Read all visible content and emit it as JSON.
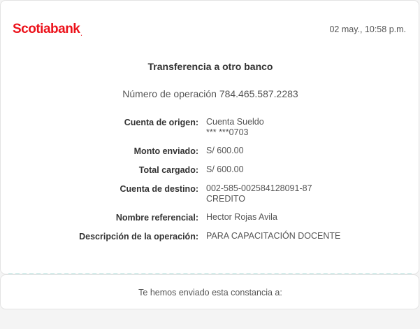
{
  "header": {
    "brand": "Scotiabank",
    "brand_mark": ".",
    "datetime": "02 may., 10:58 p.m."
  },
  "receipt": {
    "title": "Transferencia a otro banco",
    "operation_label": "Número de operación",
    "operation_number": "784.465.587.2283",
    "rows": [
      {
        "label": "Cuenta de origen:",
        "value_line1": "Cuenta Sueldo",
        "value_line2": "*** ***0703"
      },
      {
        "label": "Monto enviado:",
        "value_line1": "S/ 600.00"
      },
      {
        "label": "Total cargado:",
        "value_line1": "S/ 600.00"
      },
      {
        "label": "Cuenta de destino:",
        "value_line1": "002-585-002584128091-87",
        "value_line2": "CREDITO"
      },
      {
        "label": "Nombre referencial:",
        "value_line1": "Hector Rojas Avila"
      },
      {
        "label": "Descripción de la operación:",
        "value_line1": "PARA CAPACITACIÓN DOCENTE"
      }
    ]
  },
  "footer": {
    "sent_text": "Te hemos enviado esta constancia a:"
  },
  "colors": {
    "brand_red": "#ec111a",
    "divider": "#d4ecea"
  }
}
